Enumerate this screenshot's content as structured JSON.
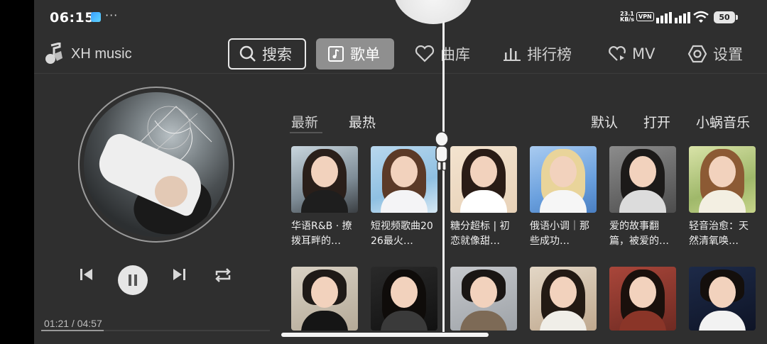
{
  "status_bar": {
    "time": "06:15",
    "dots": "···",
    "net_speed_value": "23.1",
    "net_speed_unit": "KB/s",
    "vpn": "VPN",
    "battery": "50"
  },
  "nav": {
    "app_name": "XH music",
    "items": [
      {
        "label": "搜索",
        "icon": "search-icon"
      },
      {
        "label": "歌单",
        "icon": "playlist-icon"
      },
      {
        "label": "曲库",
        "icon": "heart-icon"
      },
      {
        "label": "排行榜",
        "icon": "chart-bars-icon"
      },
      {
        "label": "MV",
        "icon": "heart-play-icon"
      },
      {
        "label": "设置",
        "icon": "hexagon-gear-icon"
      }
    ]
  },
  "player": {
    "elapsed": "01:21",
    "duration": "04:57",
    "time_display": "01:21 / 04:57",
    "progress_fraction": 0.273
  },
  "tabs": {
    "new": "最新",
    "hot": "最热",
    "default": "默认",
    "open": "打开",
    "source": "小蜗音乐"
  },
  "playlists_row1": [
    {
      "title": "华语R&B · 撩拨耳畔的…"
    },
    {
      "title": "短视频歌曲2026最火…"
    },
    {
      "title": "糖分超标 | 初恋就像甜…"
    },
    {
      "title": "俄语小调｜那些成功…"
    },
    {
      "title": "爱的故事翻篇，被爱的…"
    },
    {
      "title": "轻音治愈：天然清氧唤…"
    }
  ],
  "colors": {
    "background": "#2f2f2f",
    "accent_button": "#8f8f8f"
  }
}
